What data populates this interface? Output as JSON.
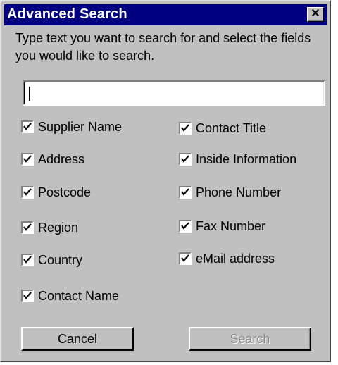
{
  "window": {
    "title": "Advanced Search",
    "close_glyph": "✕"
  },
  "instructions": "Type text you want to search for and select the fields you would like to search.",
  "search": {
    "value": ""
  },
  "fields": [
    {
      "label": "Supplier Name",
      "checked": true
    },
    {
      "label": "Address",
      "checked": true
    },
    {
      "label": "Postcode",
      "checked": true
    },
    {
      "label": "Region",
      "checked": true
    },
    {
      "label": "Country",
      "checked": true
    },
    {
      "label": "Contact Name",
      "checked": true
    },
    {
      "label": "Contact Title",
      "checked": true
    },
    {
      "label": "Inside Information",
      "checked": true
    },
    {
      "label": "Phone Number",
      "checked": true
    },
    {
      "label": "Fax Number",
      "checked": true
    },
    {
      "label": "eMail address",
      "checked": true
    }
  ],
  "buttons": {
    "cancel": "Cancel",
    "search": "Search",
    "search_enabled": false
  }
}
